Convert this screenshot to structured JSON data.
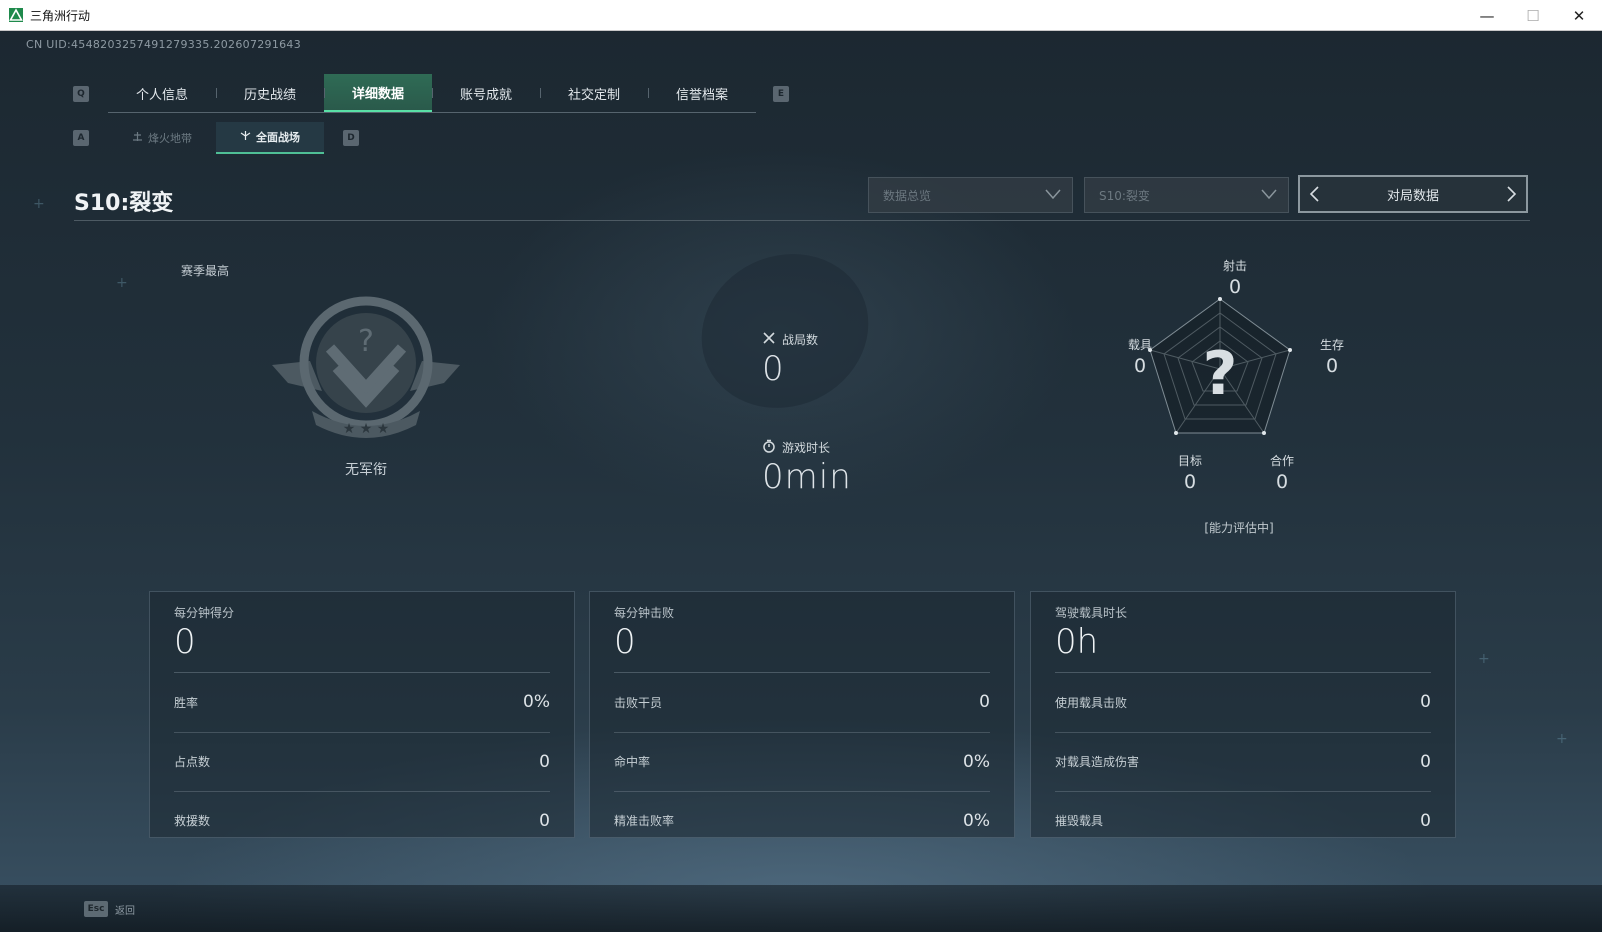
{
  "window": {
    "title": "三角洲行动",
    "minimize_glyph": "—",
    "maximize_glyph": "☐",
    "close_glyph": "✕"
  },
  "uid": "CN UID:4548203257491279335.202607291643",
  "tabs": {
    "prev_key": "Q",
    "next_key": "E",
    "items": [
      {
        "label": "个人信息"
      },
      {
        "label": "历史战绩"
      },
      {
        "label": "详细数据",
        "active": true
      },
      {
        "label": "账号成就"
      },
      {
        "label": "社交定制"
      },
      {
        "label": "信誉档案"
      }
    ]
  },
  "subtabs": {
    "prev_key": "A",
    "next_key": "D",
    "items": [
      {
        "label": "烽火地带",
        "icon": "beacon-icon"
      },
      {
        "label": "全面战场",
        "icon": "battlefield-icon",
        "active": true
      }
    ]
  },
  "season": {
    "title": "S10:裂变"
  },
  "filters": {
    "data_type": "数据总览",
    "season": "S10:裂变",
    "view": "对局数据"
  },
  "rank": {
    "label": "赛季最高",
    "name": "无军衔"
  },
  "overview": {
    "matches_label": "战局数",
    "matches_value": "0",
    "playtime_label": "游戏时长",
    "playtime_value": "0min"
  },
  "radar": {
    "center_glyph": "?",
    "axes": {
      "shooting": {
        "label": "射击",
        "value": "0"
      },
      "survival": {
        "label": "生存",
        "value": "0"
      },
      "teamwork": {
        "label": "合作",
        "value": "0"
      },
      "objective": {
        "label": "目标",
        "value": "0"
      },
      "vehicle": {
        "label": "载具",
        "value": "0"
      }
    },
    "status": "[能力评估中]"
  },
  "cards": [
    {
      "title": "每分钟得分",
      "value": "0",
      "rows": [
        {
          "label": "胜率",
          "value": "0%"
        },
        {
          "label": "占点数",
          "value": "0"
        },
        {
          "label": "救援数",
          "value": "0"
        }
      ]
    },
    {
      "title": "每分钟击败",
      "value": "0",
      "rows": [
        {
          "label": "击败干员",
          "value": "0"
        },
        {
          "label": "命中率",
          "value": "0%"
        },
        {
          "label": "精准击败率",
          "value": "0%"
        }
      ]
    },
    {
      "title": "驾驶载具时长",
      "value": "0h",
      "rows": [
        {
          "label": "使用载具击败",
          "value": "0"
        },
        {
          "label": "对载具造成伤害",
          "value": "0"
        },
        {
          "label": "摧毁载具",
          "value": "0"
        }
      ]
    }
  ],
  "footer": {
    "esc_key": "Esc",
    "back_label": "返回"
  },
  "colors": {
    "accent_green": "#59e0a6",
    "background": "#1d2a33"
  }
}
